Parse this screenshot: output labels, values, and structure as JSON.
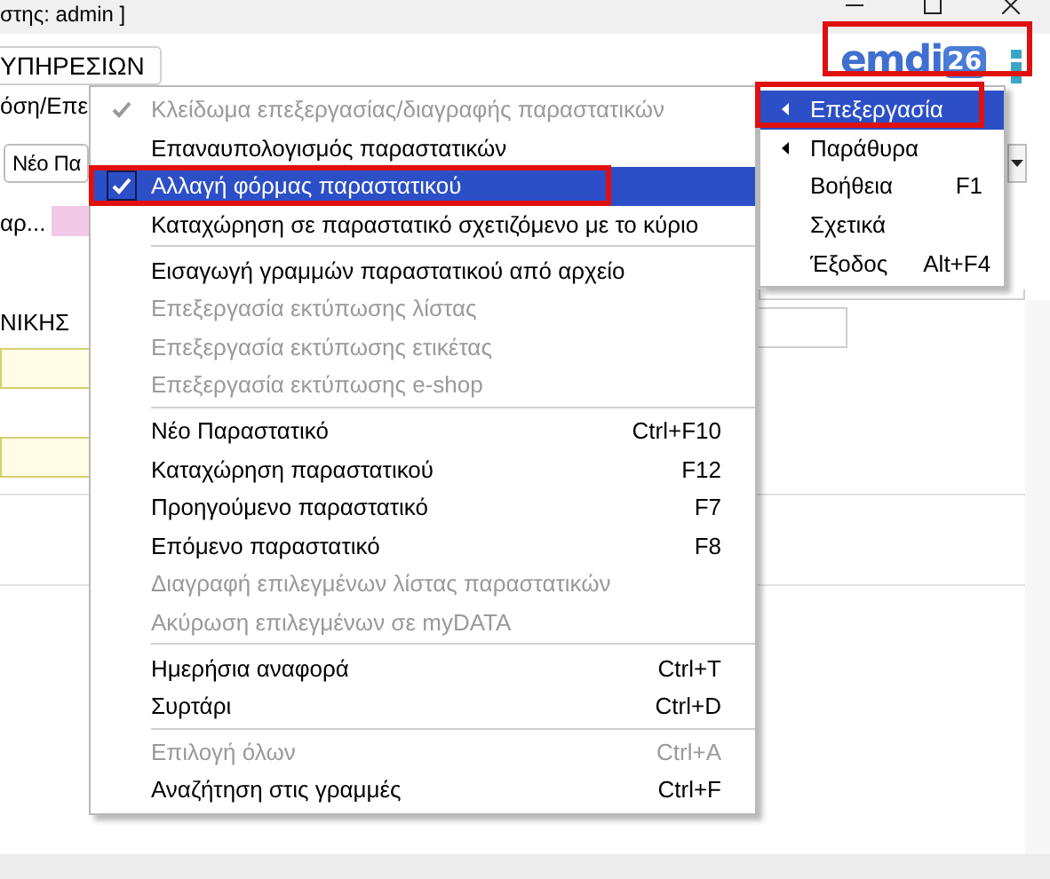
{
  "title_bar": {
    "title": "στης: admin ]"
  },
  "toolbar": {
    "button": "ΥΠΗΡΕΣΙΩΝ",
    "logo": {
      "text": "emdi",
      "badge": "26"
    }
  },
  "form": {
    "tab_label": "όση/Επε",
    "dropdown_value": "Νέο Πα",
    "field_label": "αρ...",
    "section_label": "ΝΙΚΗΣ"
  },
  "main_menu": [
    {
      "kind": "item",
      "label": "Κλείδωμα επεξεργασίας/διαγραφής παραστατικών",
      "checked": true,
      "disabled": true,
      "selected": false
    },
    {
      "kind": "item",
      "label": "Επαναυπολογισμός παραστατικών",
      "checked": false,
      "disabled": false,
      "selected": false
    },
    {
      "kind": "item",
      "label": "Αλλαγή φόρμας παραστατικού",
      "checked": true,
      "disabled": false,
      "selected": true
    },
    {
      "kind": "item",
      "label": "Καταχώρηση σε παραστατικό σχετιζόμενο με το κύριο",
      "checked": false,
      "disabled": false,
      "selected": false
    },
    {
      "kind": "separator"
    },
    {
      "kind": "item",
      "label": "Εισαγωγή γραμμών παραστατικού από αρχείο",
      "checked": false,
      "disabled": false,
      "selected": false
    },
    {
      "kind": "item",
      "label": "Επεξεργασία εκτύπωσης λίστας",
      "checked": false,
      "disabled": true,
      "selected": false
    },
    {
      "kind": "item",
      "label": "Επεξεργασία εκτύπωσης ετικέτας",
      "checked": false,
      "disabled": true,
      "selected": false
    },
    {
      "kind": "item",
      "label": "Επεξεργασία εκτύπωσης e-shop",
      "checked": false,
      "disabled": true,
      "selected": false
    },
    {
      "kind": "separator"
    },
    {
      "kind": "item",
      "label": "Νέο Παραστατικό",
      "shortcut": "Ctrl+F10",
      "checked": false,
      "disabled": false,
      "selected": false
    },
    {
      "kind": "item",
      "label": "Καταχώρηση παραστατικού",
      "shortcut": "F12",
      "checked": false,
      "disabled": false,
      "selected": false
    },
    {
      "kind": "item",
      "label": "Προηγούμενο παραστατικό",
      "shortcut": "F7",
      "checked": false,
      "disabled": false,
      "selected": false
    },
    {
      "kind": "item",
      "label": "Επόμενο παραστατικό",
      "shortcut": "F8",
      "checked": false,
      "disabled": false,
      "selected": false
    },
    {
      "kind": "item",
      "label": "Διαγραφή επιλεγμένων λίστας παραστατικών",
      "checked": false,
      "disabled": true,
      "selected": false
    },
    {
      "kind": "item",
      "label": "Ακύρωση επιλεγμένων σε myDATA",
      "checked": false,
      "disabled": true,
      "selected": false
    },
    {
      "kind": "separator"
    },
    {
      "kind": "item",
      "label": "Ημερήσια αναφορά",
      "shortcut": "Ctrl+T",
      "checked": false,
      "disabled": false,
      "selected": false
    },
    {
      "kind": "item",
      "label": "Συρτάρι",
      "shortcut": "Ctrl+D",
      "checked": false,
      "disabled": false,
      "selected": false
    },
    {
      "kind": "separator"
    },
    {
      "kind": "item",
      "label": "Επιλογή όλων",
      "shortcut": "Ctrl+A",
      "checked": false,
      "disabled": true,
      "selected": false
    },
    {
      "kind": "item",
      "label": "Αναζήτηση στις γραμμές",
      "shortcut": "Ctrl+F",
      "checked": false,
      "disabled": false,
      "selected": false
    }
  ],
  "side_menu": [
    {
      "label": "Επεξεργασία",
      "has_submenu": true,
      "selected": true
    },
    {
      "label": "Παράθυρα",
      "has_submenu": true,
      "selected": false
    },
    {
      "label": "Βοήθεια",
      "shortcut": "F1",
      "has_submenu": false,
      "selected": false
    },
    {
      "label": "Σχετικά",
      "has_submenu": false,
      "selected": false
    },
    {
      "label": "Έξοδος",
      "shortcut": "Alt+F4",
      "has_submenu": false,
      "selected": false
    }
  ]
}
